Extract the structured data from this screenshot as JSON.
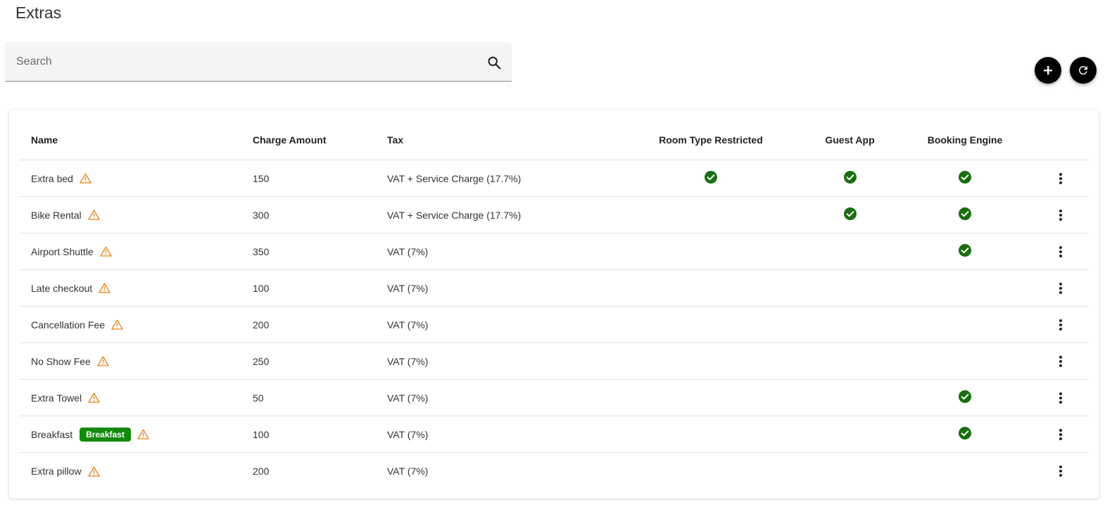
{
  "page": {
    "title": "Extras"
  },
  "search": {
    "placeholder": "Search",
    "value": ""
  },
  "actions": {
    "add_icon": "plus-icon",
    "refresh_icon": "refresh-icon"
  },
  "colors": {
    "check": "#1a7a12",
    "warning": "#e8821a",
    "badge": "#138a0c",
    "fab": "#000000"
  },
  "table": {
    "headers": {
      "name": "Name",
      "amount": "Charge Amount",
      "tax": "Tax",
      "room": "Room Type Restricted",
      "guest": "Guest App",
      "booking": "Booking Engine"
    },
    "rows": [
      {
        "name": "Extra bed",
        "badge": "",
        "amount": "150",
        "tax": "VAT + Service Charge (17.7%)",
        "room": true,
        "guest": true,
        "booking": true
      },
      {
        "name": "Bike Rental",
        "badge": "",
        "amount": "300",
        "tax": "VAT + Service Charge (17.7%)",
        "room": false,
        "guest": true,
        "booking": true
      },
      {
        "name": "Airport Shuttle",
        "badge": "",
        "amount": "350",
        "tax": "VAT (7%)",
        "room": false,
        "guest": false,
        "booking": true
      },
      {
        "name": "Late checkout",
        "badge": "",
        "amount": "100",
        "tax": "VAT (7%)",
        "room": false,
        "guest": false,
        "booking": false
      },
      {
        "name": "Cancellation Fee",
        "badge": "",
        "amount": "200",
        "tax": "VAT (7%)",
        "room": false,
        "guest": false,
        "booking": false
      },
      {
        "name": "No Show Fee",
        "badge": "",
        "amount": "250",
        "tax": "VAT (7%)",
        "room": false,
        "guest": false,
        "booking": false
      },
      {
        "name": "Extra Towel",
        "badge": "",
        "amount": "50",
        "tax": "VAT (7%)",
        "room": false,
        "guest": false,
        "booking": true
      },
      {
        "name": "Breakfast",
        "badge": "Breakfast",
        "amount": "100",
        "tax": "VAT (7%)",
        "room": false,
        "guest": false,
        "booking": true
      },
      {
        "name": "Extra pillow",
        "badge": "",
        "amount": "200",
        "tax": "VAT (7%)",
        "room": false,
        "guest": false,
        "booking": false
      }
    ]
  }
}
